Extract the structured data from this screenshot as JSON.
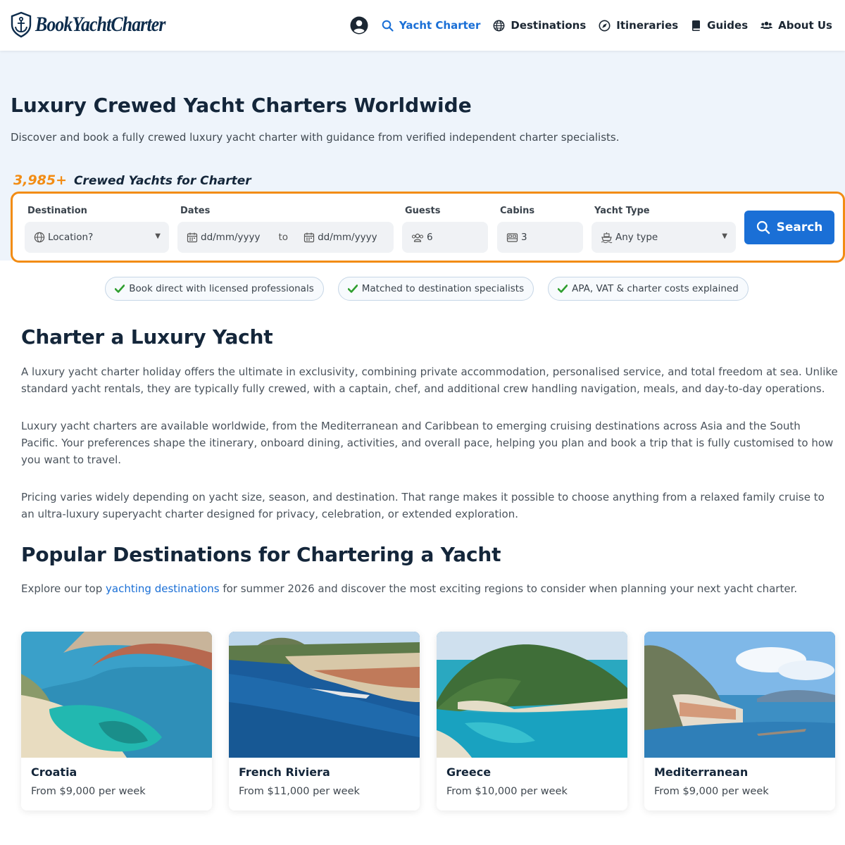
{
  "brand": {
    "name": "BookYachtCharter"
  },
  "nav": {
    "items": [
      {
        "label": "Yacht Charter",
        "icon": "search-icon",
        "active": true
      },
      {
        "label": "Destinations",
        "icon": "globe-icon"
      },
      {
        "label": "Itineraries",
        "icon": "compass-icon"
      },
      {
        "label": "Guides",
        "icon": "book-icon"
      },
      {
        "label": "About Us",
        "icon": "users-icon"
      }
    ]
  },
  "hero": {
    "title": "Luxury Crewed Yacht Charters Worldwide",
    "subtitle": "Discover and book a fully crewed luxury yacht charter with guidance from verified independent charter specialists.",
    "count": "3,985+",
    "count_label": "Crewed Yachts for Charter"
  },
  "search": {
    "destination": {
      "label": "Destination",
      "value": "Location?"
    },
    "dates": {
      "label": "Dates",
      "from_placeholder": "dd/mm/yyyy",
      "to_label": "to",
      "to_placeholder": "dd/mm/yyyy"
    },
    "guests": {
      "label": "Guests",
      "value": "6"
    },
    "cabins": {
      "label": "Cabins",
      "value": "3"
    },
    "yacht_type": {
      "label": "Yacht Type",
      "value": "Any type"
    },
    "button_label": "Search"
  },
  "pills": [
    "Book direct with licensed professionals",
    "Matched to destination specialists",
    "APA, VAT & charter costs explained"
  ],
  "section1": {
    "title": "Charter a Luxury Yacht",
    "paragraphs": [
      "A luxury yacht charter holiday offers the ultimate in exclusivity, combining private accommodation, personalised service, and total freedom at sea. Unlike standard yacht rentals, they are typically fully crewed, with a captain, chef, and additional crew handling navigation, meals, and day-to-day operations.",
      "Luxury yacht charters are available worldwide, from the Mediterranean and Caribbean to emerging cruising destinations across Asia and the South Pacific. Your preferences shape the itinerary, onboard dining, activities, and overall pace, helping you plan and book a trip that is fully customised to how you want to travel.",
      "Pricing varies widely depending on yacht size, season, and destination. That range makes it possible to choose anything from a relaxed family cruise to an ultra-luxury superyacht charter designed for privacy, celebration, or extended exploration."
    ]
  },
  "section2": {
    "title": "Popular Destinations for Chartering a Yacht",
    "intro_before": "Explore our top ",
    "intro_link": "yachting destinations",
    "intro_after": " for summer 2026 and discover the most exciting regions to consider when planning your next yacht charter."
  },
  "destinations": [
    {
      "name": "Croatia",
      "price": "From $9,000 per week"
    },
    {
      "name": "French Riviera",
      "price": "From $11,000 per week"
    },
    {
      "name": "Greece",
      "price": "From $10,000 per week"
    },
    {
      "name": "Mediterranean",
      "price": "From $9,000 per week"
    }
  ],
  "colors": {
    "accent": "#1a6fd6",
    "highlight": "#f28c14",
    "heading": "#14263a",
    "hero_bg": "#eef4fb"
  }
}
